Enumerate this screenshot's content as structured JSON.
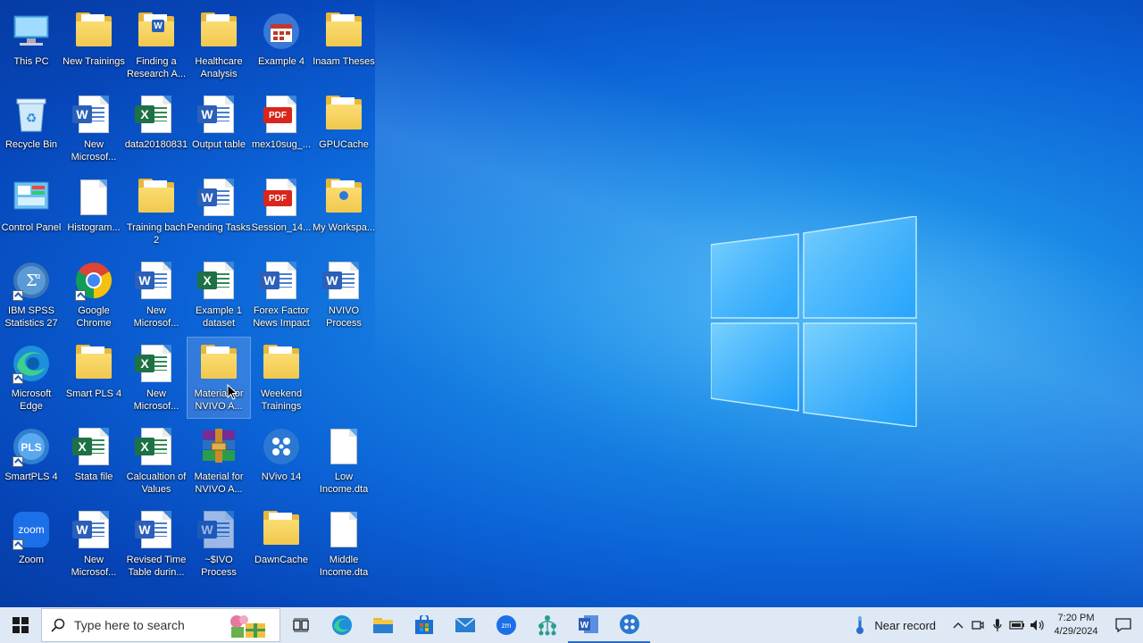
{
  "desktop": {
    "icons": [
      {
        "label": "This PC"
      },
      {
        "label": "New Trainings"
      },
      {
        "label": "Finding a Research A..."
      },
      {
        "label": "Healthcare Analysis"
      },
      {
        "label": "Example 4"
      },
      {
        "label": "Inaam Theses"
      },
      {
        "label": "Recycle Bin"
      },
      {
        "label": "New Microsof..."
      },
      {
        "label": "data20180831"
      },
      {
        "label": "Output table"
      },
      {
        "label": "mex10sug_..."
      },
      {
        "label": "GPUCache"
      },
      {
        "label": "Control Panel"
      },
      {
        "label": "Histogram..."
      },
      {
        "label": "Training bach 2"
      },
      {
        "label": "Pending Tasks"
      },
      {
        "label": "Session_14..."
      },
      {
        "label": "My Workspa..."
      },
      {
        "label": "IBM SPSS Statistics 27"
      },
      {
        "label": "Google Chrome"
      },
      {
        "label": "New Microsof..."
      },
      {
        "label": "Example 1 dataset"
      },
      {
        "label": "Forex Factor News Impact"
      },
      {
        "label": "NVIVO Process"
      },
      {
        "label": "Microsoft Edge"
      },
      {
        "label": "Smart PLS 4"
      },
      {
        "label": "New Microsof..."
      },
      {
        "label": "Material for NVIVO A..."
      },
      {
        "label": "Weekend Trainings"
      },
      {
        "label": "SmartPLS 4"
      },
      {
        "label": "Stata file"
      },
      {
        "label": "Calcualtion of Values"
      },
      {
        "label": "Material for NVIVO A..."
      },
      {
        "label": "NVivo 14"
      },
      {
        "label": "Low Income.dta"
      },
      {
        "label": "Zoom"
      },
      {
        "label": "New Microsof..."
      },
      {
        "label": "Revised Time Table durin..."
      },
      {
        "label": "~$IVO Process"
      },
      {
        "label": "DawnCache"
      },
      {
        "label": "Middle Income.dta"
      }
    ]
  },
  "taskbar": {
    "search_placeholder": "Type here to search",
    "weather_text": "Near record",
    "time": "7:20 PM",
    "date": "4/29/2024",
    "app_icons": [
      "task-view-icon",
      "edge-icon",
      "file-explorer-icon",
      "store-icon",
      "mail-icon",
      "zoom-icon",
      "nvivo-tree-icon",
      "word-icon",
      "nvivo-icon"
    ]
  },
  "colors": {
    "taskbar_bg": "#dfe9f5",
    "folder": "#f1c84d",
    "word": "#2b5fb8",
    "excel": "#1e7145",
    "pdf": "#d9261c"
  }
}
